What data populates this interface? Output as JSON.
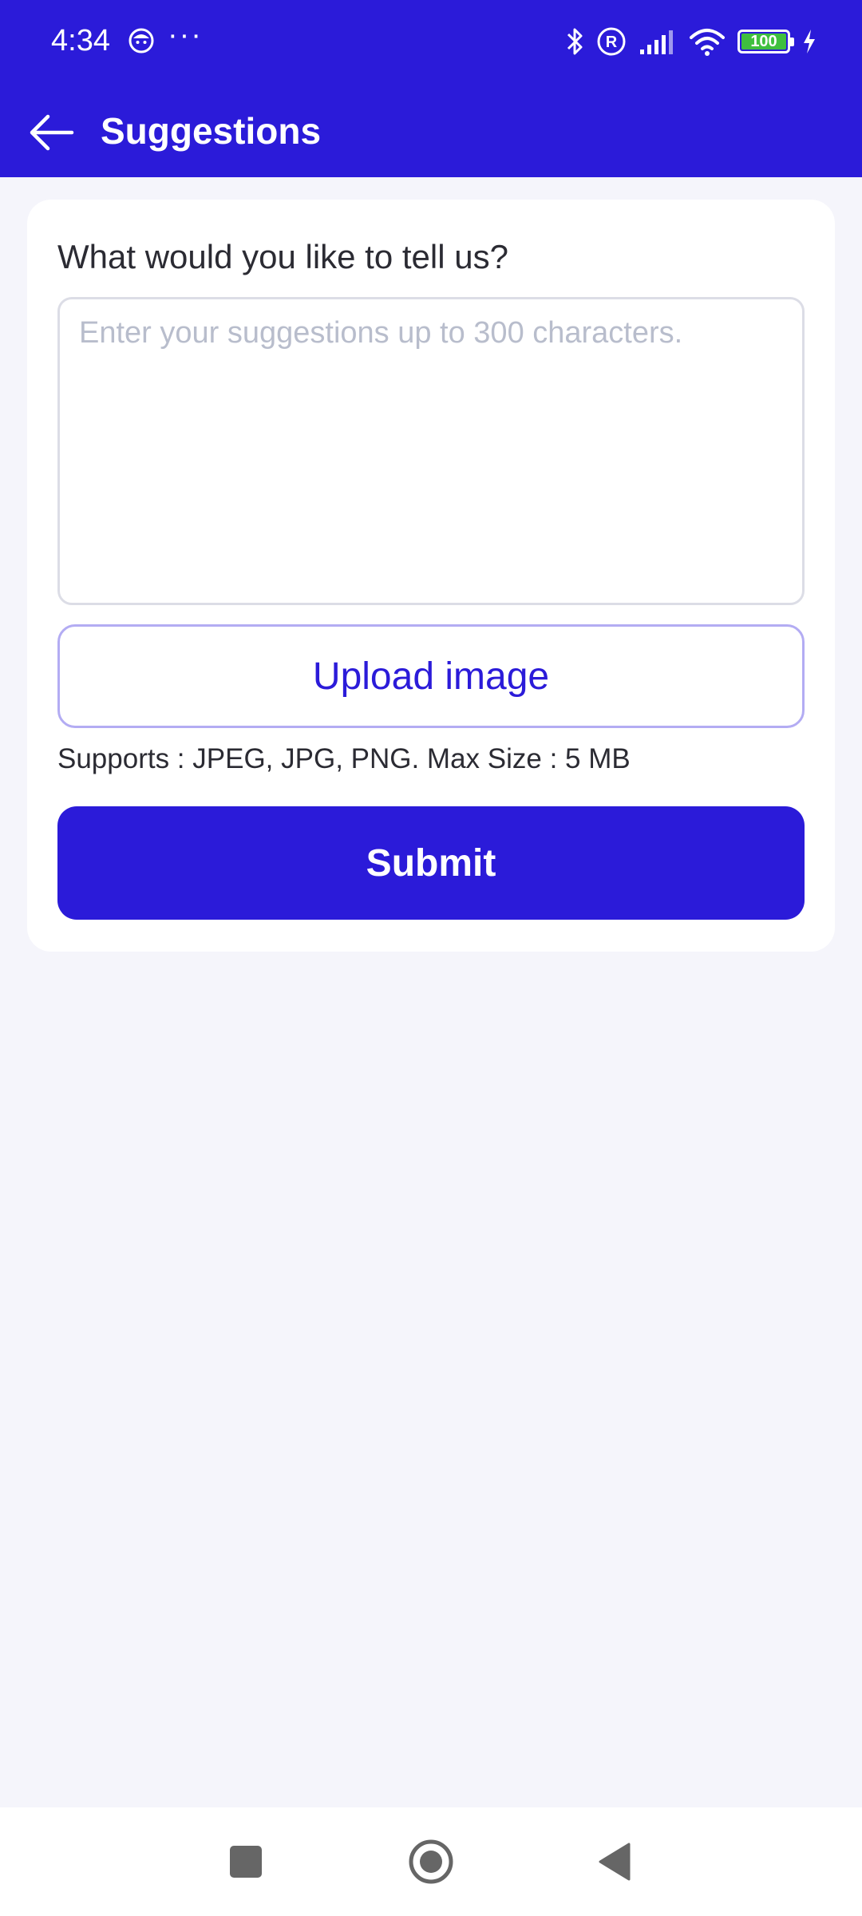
{
  "status_bar": {
    "time": "4:34",
    "more": "···",
    "battery": "100",
    "icons": [
      "face-icon",
      "bluetooth-icon",
      "registered-icon",
      "signal-icon",
      "wifi-icon",
      "battery-icon",
      "charging-icon"
    ],
    "battery_color": "#3fbf3f"
  },
  "app_bar": {
    "title": "Suggestions",
    "back_icon": "arrow-left-icon"
  },
  "form": {
    "prompt": "What would you like to tell us?",
    "input_value": "",
    "input_placeholder": "Enter your suggestions up to 300 characters.",
    "upload_label": "Upload image",
    "supports_note": "Supports : JPEG, JPG, PNG. Max Size : 5 MB",
    "submit_label": "Submit"
  },
  "nav_bar": {
    "icons": [
      "recents-square-icon",
      "home-circle-icon",
      "back-triangle-icon"
    ]
  },
  "colors": {
    "brand": "#2b1bd9",
    "background": "#f5f5fb",
    "card": "#ffffff",
    "upload_border": "#b3acf3",
    "placeholder": "#b8bdcc"
  }
}
